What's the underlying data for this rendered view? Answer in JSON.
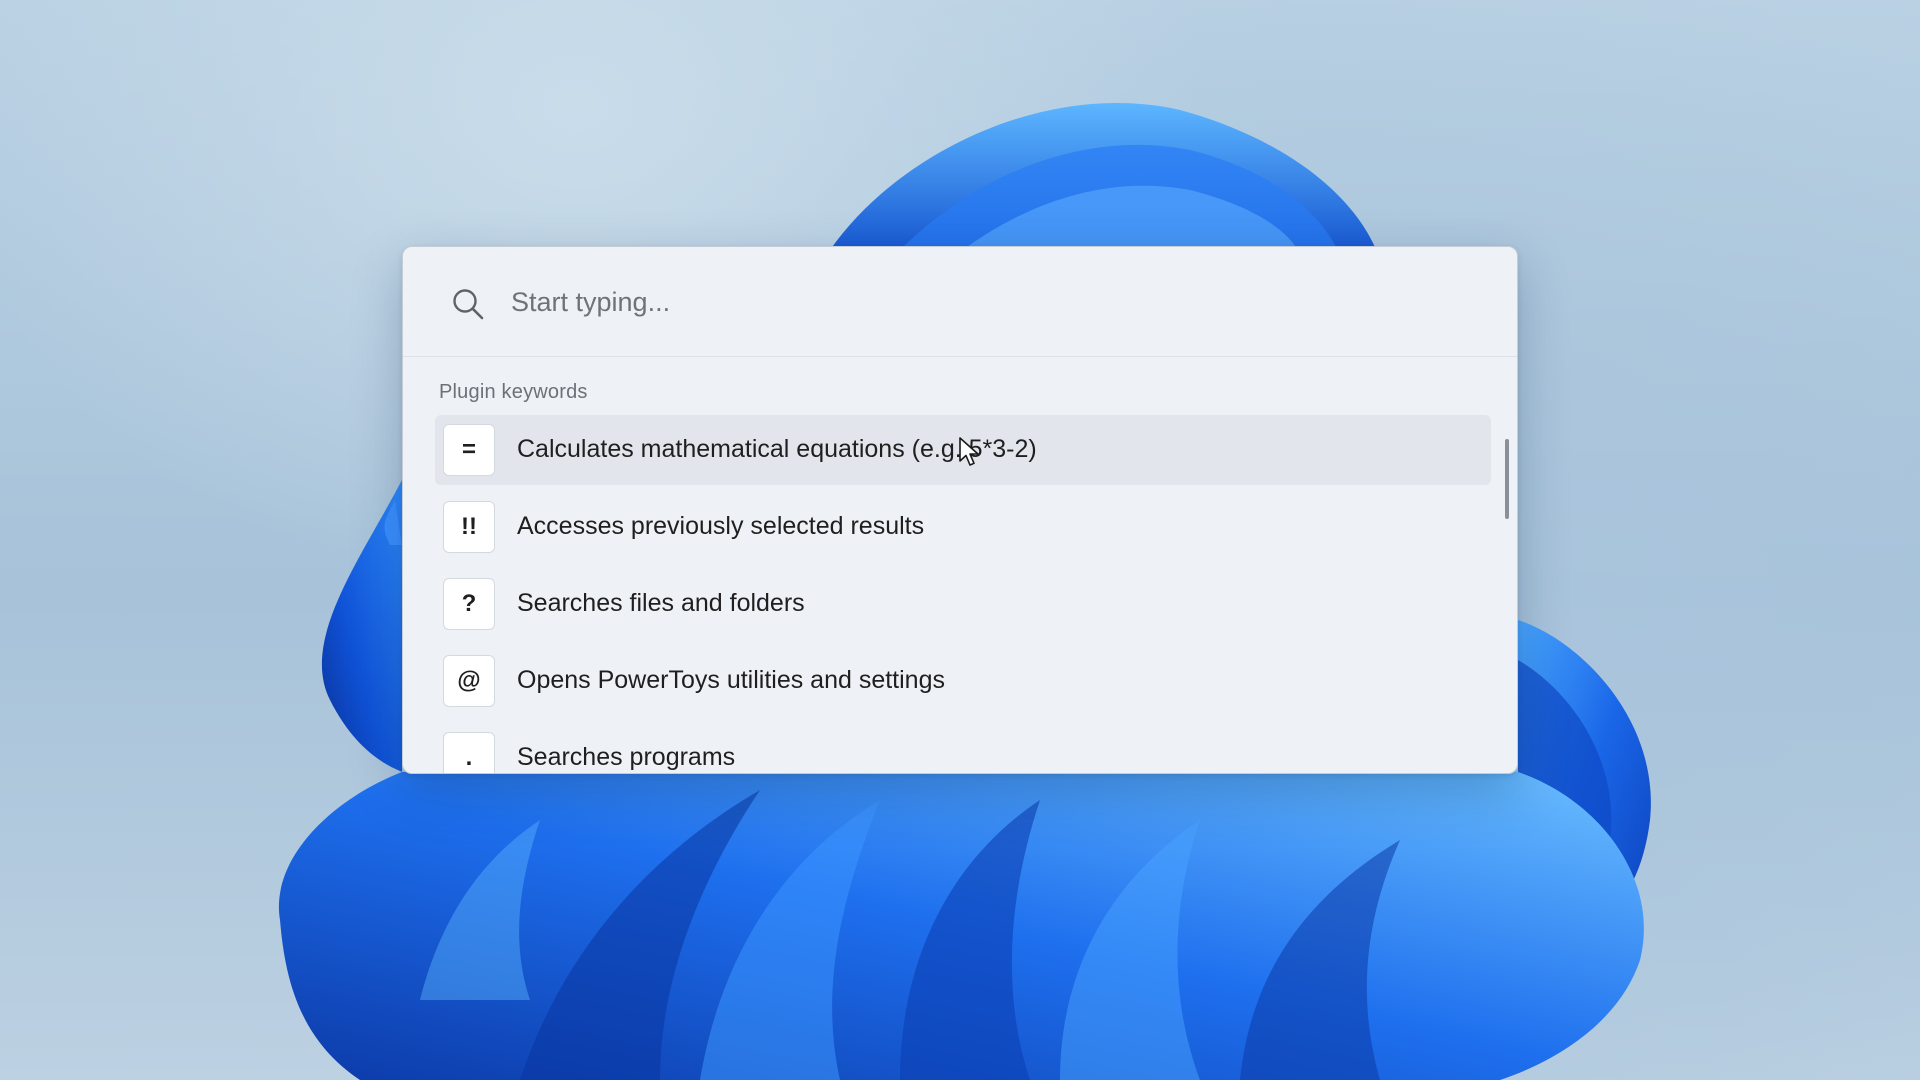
{
  "search": {
    "placeholder": "Start typing...",
    "value": ""
  },
  "section": {
    "title": "Plugin keywords"
  },
  "results": [
    {
      "keyword": "=",
      "label": "Calculates mathematical equations (e.g. 5*3-2)",
      "selected": true
    },
    {
      "keyword": "!!",
      "label": "Accesses previously selected results",
      "selected": false
    },
    {
      "keyword": "?",
      "label": "Searches files and folders",
      "selected": false
    },
    {
      "keyword": "@",
      "label": "Opens PowerToys utilities and settings",
      "selected": false
    },
    {
      "keyword": ".",
      "label": "Searches programs",
      "selected": false
    }
  ],
  "icons": {
    "search": "search-icon",
    "cursor": "mouse-pointer-icon"
  },
  "colors": {
    "panel_background": "#eef1f6",
    "selected_row": "#e2e6ec",
    "wallpaper_blue": "#1e6be6"
  }
}
